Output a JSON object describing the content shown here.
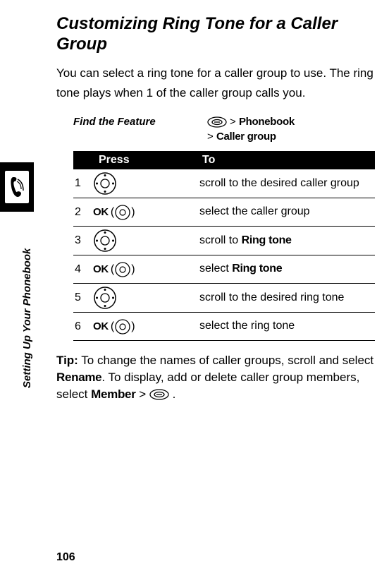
{
  "title": "Customizing Ring Tone for a Caller Group",
  "intro": "You can select a ring tone for a caller group to use. The ring tone plays when 1 of the caller group calls you.",
  "feature": {
    "label": "Find the Feature",
    "path1_gt": ">",
    "path1": "Phonebook",
    "path2_gt": ">",
    "path2": "Caller group"
  },
  "table": {
    "head": {
      "press": "Press",
      "to": "To"
    },
    "rows": [
      {
        "num": "1",
        "press_type": "nav",
        "to_pre": "scroll to the desired caller group"
      },
      {
        "num": "2",
        "press_type": "ok",
        "ok": "OK",
        "to_pre": "select the caller group"
      },
      {
        "num": "3",
        "press_type": "nav",
        "to_pre": "scroll to ",
        "to_bold": "Ring tone"
      },
      {
        "num": "4",
        "press_type": "ok",
        "ok": "OK",
        "to_pre": "select ",
        "to_bold": "Ring tone"
      },
      {
        "num": "5",
        "press_type": "nav",
        "to_pre": "scroll to the desired ring tone"
      },
      {
        "num": "6",
        "press_type": "ok",
        "ok": "OK",
        "to_pre": "select the ring tone"
      }
    ]
  },
  "tip": {
    "label": "Tip:",
    "t1": " To change the names of caller groups, scroll and select ",
    "b1": "Rename",
    "t2": ". To display, add or delete caller group members, select ",
    "b2": "Member",
    "t3": " > ",
    "t4": " ."
  },
  "sidebar": "Setting Up Your Phonebook",
  "page": "106"
}
